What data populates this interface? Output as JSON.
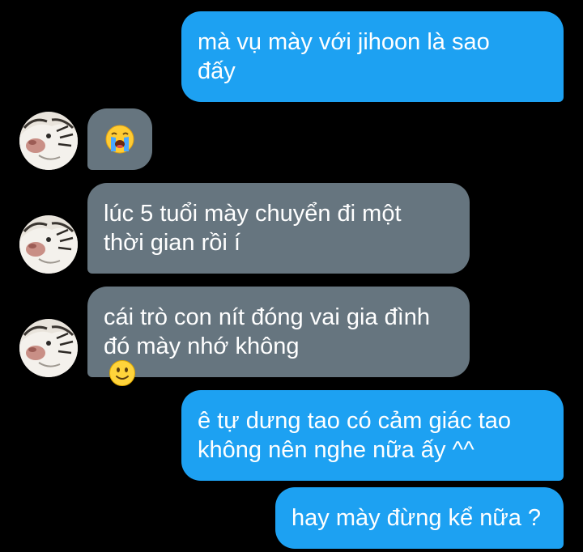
{
  "conversation": {
    "messages": [
      {
        "side": "sent",
        "text": "mà vụ mày với jihoon là sao\nđấy"
      },
      {
        "side": "received",
        "emoji": "loudly-crying-face"
      },
      {
        "side": "received",
        "text": "lúc 5 tuổi mày chuyển đi một\nthời gian rồi í"
      },
      {
        "side": "received",
        "text": "cái trò con nít đóng vai gia đình\nđó mày nhớ không",
        "emoji": "slightly-smiling-face"
      },
      {
        "side": "sent",
        "text": "ê tự dưng tao có cảm giác tao\nkhông nên nghe nữa ấy ^^"
      },
      {
        "side": "sent",
        "text": "hay mày đừng kể nữa ?"
      }
    ]
  },
  "colors": {
    "background": "#000000",
    "sent_bubble": "#1da1f2",
    "received_bubble": "#66757f",
    "text": "#ffffff"
  },
  "icons": {
    "contact_avatar": "white-tiger-avatar-icon"
  }
}
